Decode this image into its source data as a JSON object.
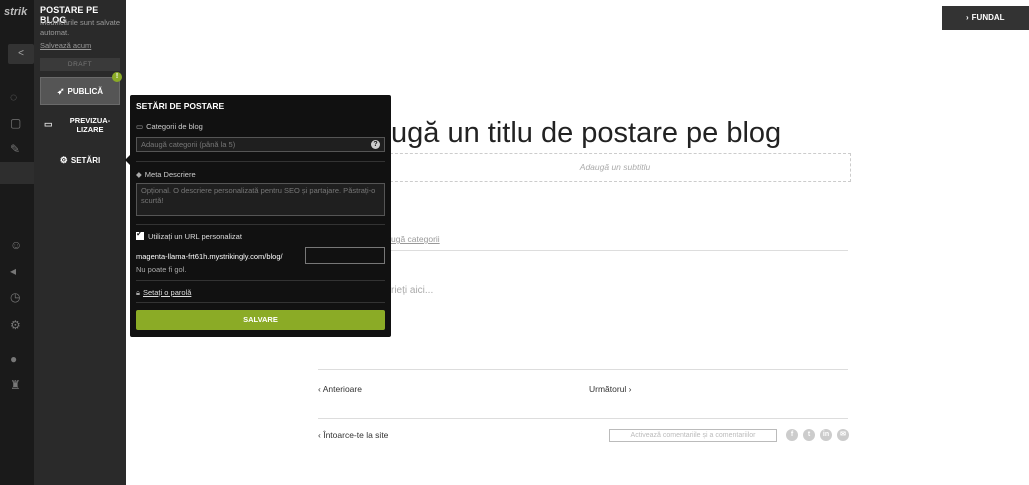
{
  "rail": {
    "logo": "strik",
    "back_label": "<"
  },
  "sidebar": {
    "title": "POSTARE PE BLOG",
    "note": "Modificările sunt salvate automat.",
    "save_now": "Salvează acum",
    "draft_label": "DRAFT",
    "publish_label": "PUBLICĂ",
    "warning_badge": "!",
    "preview_label": "PREVIZUA-LIZARE",
    "settings_label": "SETĂRI"
  },
  "popover": {
    "title": "SETĂRI DE POSTARE",
    "categories_label": "Categorii de blog",
    "categories_placeholder": "Adaugă categorii (până la 5)",
    "help_badge": "?",
    "meta_label": "Meta Descriere",
    "meta_placeholder": "Opțional. O descriere personalizată pentru SEO și partajare. Păstrați-o scurtă!",
    "custom_url_label": "Utilizați un URL personalizat",
    "url_prefix": "magenta-llama-frt61h.mystrikingly.com/blog/",
    "url_value": "",
    "url_error": "Nu poate fi gol.",
    "password_link": "Setați o parolă",
    "save_label": "SALVARE"
  },
  "canvas": {
    "background_button": "FUNDAL",
    "post_title": "ugă un titlu de postare pe blog",
    "subtitle_placeholder": "Adaugă un subtitlu",
    "add_categories": "ugă categorii",
    "body_placeholder": "rieți aici...",
    "prev_label": "Anterioare",
    "next_label": "Următorul",
    "back_to_site": "Întoarce-te la site",
    "comments_button": "Activează comentariile și a comentariilor",
    "social": [
      "f",
      "t",
      "in",
      "✉"
    ]
  },
  "colors": {
    "accent": "#8bab26",
    "popover_bg": "#111111",
    "sidebar_bg": "#2a2a2a"
  },
  "icons": {
    "publish": "rocket-icon",
    "preview": "monitor-icon",
    "settings": "gear-icon",
    "categories": "folder-icon",
    "meta": "tag-icon",
    "password": "lock-icon"
  }
}
